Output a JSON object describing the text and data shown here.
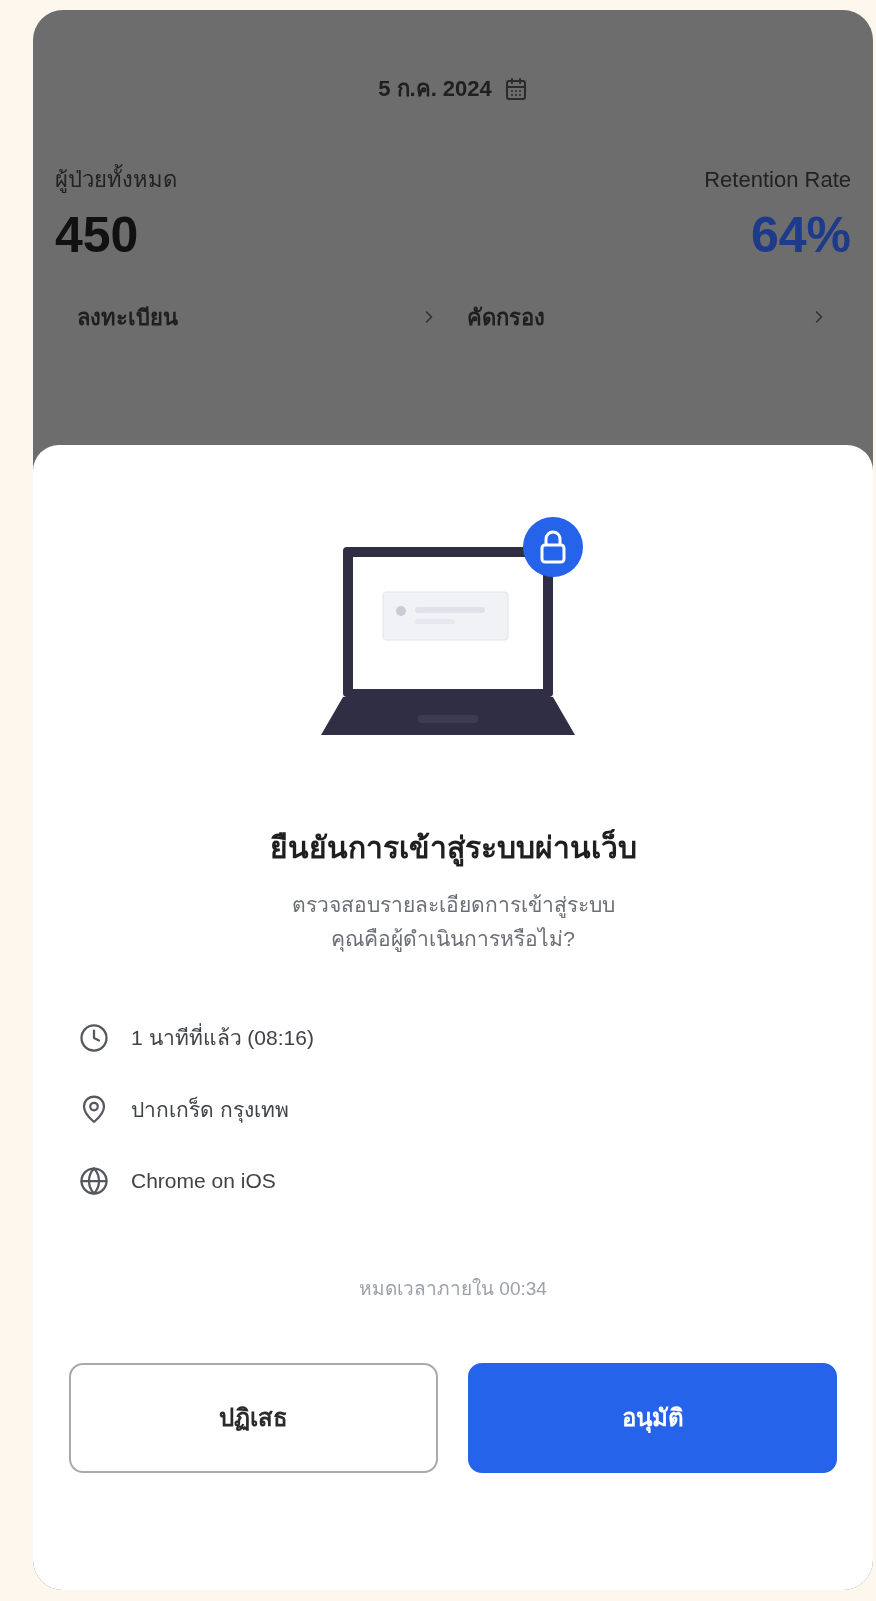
{
  "background": {
    "date": "5 ก.ค. 2024",
    "stats": [
      {
        "label": "ผู้ป่วยทั้งหมด",
        "value": "450",
        "kind": "plain"
      },
      {
        "label": "Retention Rate",
        "value": "64%",
        "kind": "accent"
      }
    ],
    "links": [
      {
        "label": "ลงทะเบียน"
      },
      {
        "label": "คัดกรอง"
      }
    ]
  },
  "sheet": {
    "title": "ยืนยันการเข้าสู่ระบบผ่านเว็บ",
    "subtitle": [
      "ตรวจสอบรายละเอียดการเข้าสู่ระบบ",
      "คุณคือผู้ดำเนินการหรือไม่?"
    ],
    "details": [
      {
        "kind": "time",
        "text": "1 นาทีที่แล้ว (08:16)"
      },
      {
        "kind": "location",
        "text": "ปากเกร็ด กรุงเทพ"
      },
      {
        "kind": "browser",
        "text": "Chrome on iOS"
      }
    ],
    "countdown": "หมดเวลาภายใน 00:34",
    "buttons": [
      {
        "label": "ปฏิเสธ",
        "kind": "secondary"
      },
      {
        "label": "อนุมัติ",
        "kind": "primary"
      }
    ]
  }
}
